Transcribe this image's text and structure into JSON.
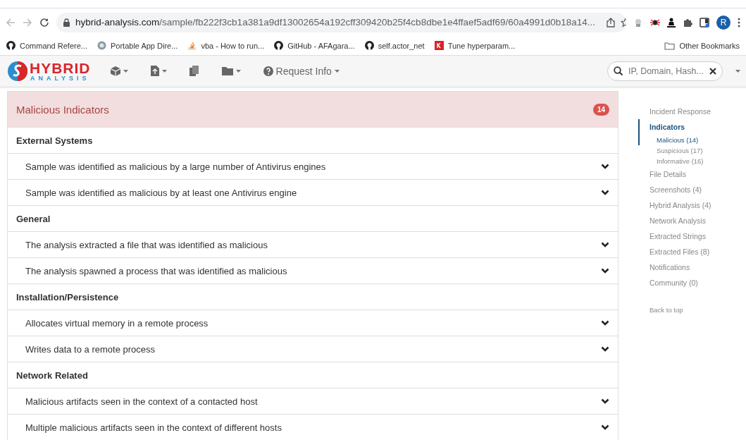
{
  "browser": {
    "url_host": "hybrid-analysis.com",
    "url_path": "/sample/fb222f3cb1a381a9df13002654a192cff309420b25f4cb8dbe1e4ffaef5adf69/60a4991d0b18a14...",
    "profile": "R",
    "bookmarks": [
      {
        "label": "Command Refere...",
        "kind": "github"
      },
      {
        "label": "Portable App Dire...",
        "kind": "globe"
      },
      {
        "label": "vba - How to run...",
        "kind": "stack"
      },
      {
        "label": "GitHub - AFAgara...",
        "kind": "github"
      },
      {
        "label": "self.actor_net",
        "kind": "github"
      },
      {
        "label": "Tune hyperparam...",
        "kind": "k"
      }
    ],
    "other_bookmarks": "Other Bookmarks"
  },
  "nav": {
    "logo_top": "HYBRID",
    "logo_bottom": "ANALYSIS",
    "request_info": "Request Info",
    "search_placeholder": "IP, Domain, Hash..."
  },
  "panel": {
    "title": "Malicious Indicators",
    "count": "14",
    "groups": [
      {
        "title": "External Systems",
        "items": [
          {
            "text": "Sample was identified as malicious by a large number of Antivirus engines",
            "expanded": false
          },
          {
            "text": "Sample was identified as malicious by at least one Antivirus engine",
            "expanded": false
          }
        ]
      },
      {
        "title": "General",
        "items": [
          {
            "text": "The analysis extracted a file that was identified as malicious",
            "expanded": false
          },
          {
            "text": "The analysis spawned a process that was identified as malicious",
            "expanded": false
          }
        ]
      },
      {
        "title": "Installation/Persistence",
        "items": [
          {
            "text": "Allocates virtual memory in a remote process",
            "expanded": false
          },
          {
            "text": "Writes data to a remote process",
            "expanded": false
          }
        ]
      },
      {
        "title": "Network Related",
        "items": [
          {
            "text": "Malicious artifacts seen in the context of a contacted host",
            "expanded": false
          },
          {
            "text": "Multiple malicious artifacts seen in the context of different hosts",
            "expanded": false
          }
        ]
      }
    ]
  },
  "sidebar": {
    "items": [
      {
        "label": "Incident Response",
        "selected": false
      },
      {
        "label": "Indicators",
        "selected": true,
        "children": [
          {
            "label": "Malicious (14)",
            "selected": true
          },
          {
            "label": "Suspicious (17)",
            "selected": false
          },
          {
            "label": "Informative (16)",
            "selected": false
          }
        ]
      },
      {
        "label": "File Details",
        "selected": false
      },
      {
        "label": "Screenshots (4)",
        "selected": false
      },
      {
        "label": "Hybrid Analysis (4)",
        "selected": false
      },
      {
        "label": "Network Analysis",
        "selected": false
      },
      {
        "label": "Extracted Strings",
        "selected": false
      },
      {
        "label": "Extracted Files (8)",
        "selected": false
      },
      {
        "label": "Notifications",
        "selected": false
      },
      {
        "label": "Community (0)",
        "selected": false
      }
    ],
    "back_to_top": "Back to top"
  }
}
